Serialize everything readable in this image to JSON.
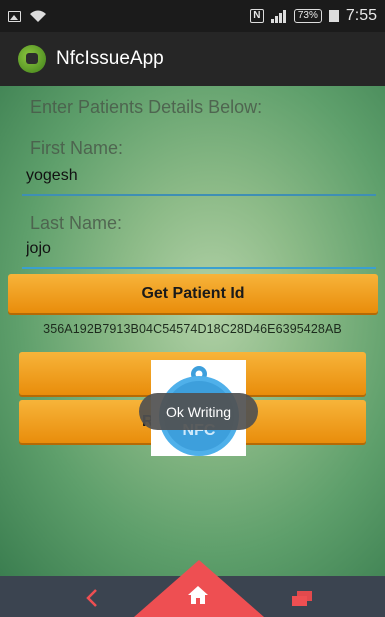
{
  "status_bar": {
    "time": "7:55",
    "battery": "73%",
    "nfc_badge": "N",
    "icons": [
      "image-icon",
      "wifi-icon",
      "nfc-icon",
      "signal-icon",
      "battery-icon"
    ]
  },
  "app": {
    "title": "NfcIssueApp"
  },
  "form": {
    "heading": "Enter Patients Details Below:",
    "first_name_label": "First Name:",
    "first_name_value": "yogesh",
    "last_name_label": "Last Name:",
    "last_name_value": "jojo"
  },
  "buttons": {
    "get_patient_id": "Get Patient Id",
    "write_data": "Write Data",
    "read_nfc_tag": "Read Nfc Tag"
  },
  "patient_id": "356A192B7913B04C54574D18C28D46E6395428AB",
  "nfc_image_label": "NFC",
  "toast": "Ok Writing",
  "colors": {
    "button": "#f0a020",
    "nav_home": "#ee4f52",
    "nav_bar": "#3b4450",
    "underline": "#3f8fb4"
  }
}
